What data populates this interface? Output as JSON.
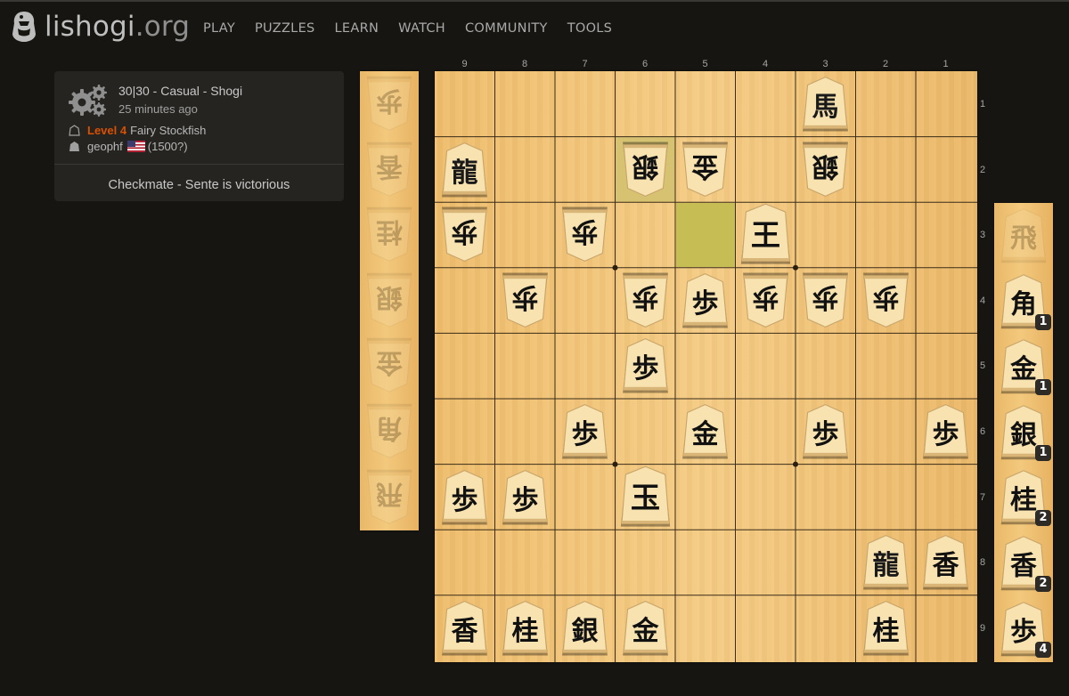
{
  "site": {
    "logo_name": "lishogi",
    "logo_tld": ".org",
    "nav": [
      "PLAY",
      "PUZZLES",
      "LEARN",
      "WATCH",
      "COMMUNITY",
      "TOOLS"
    ]
  },
  "game": {
    "title": "30|30 - Casual - Shogi",
    "time_ago": "25 minutes ago",
    "players": [
      {
        "level": "Level 4",
        "name": "Fairy Stockfish",
        "side": "gote"
      },
      {
        "name": "geophf",
        "flag": "us-flag",
        "rating": "(1500?)",
        "side": "sente"
      }
    ],
    "result": "Checkmate - Sente is victorious"
  },
  "board": {
    "files": [
      "9",
      "8",
      "7",
      "6",
      "5",
      "4",
      "3",
      "2",
      "1"
    ],
    "ranks": [
      "1",
      "2",
      "3",
      "4",
      "5",
      "6",
      "7",
      "8",
      "9"
    ],
    "highlights": [
      {
        "file": 6,
        "rank": 2,
        "color": "#d6c271"
      },
      {
        "file": 5,
        "rank": 3,
        "color": "#c7bd55"
      }
    ],
    "pieces": [
      {
        "file": 3,
        "rank": 1,
        "kanji": "馬",
        "owner": "sente"
      },
      {
        "file": 9,
        "rank": 2,
        "kanji": "龍",
        "owner": "sente"
      },
      {
        "file": 6,
        "rank": 2,
        "kanji": "銀",
        "owner": "gote"
      },
      {
        "file": 5,
        "rank": 2,
        "kanji": "金",
        "owner": "gote"
      },
      {
        "file": 3,
        "rank": 2,
        "kanji": "銀",
        "owner": "gote"
      },
      {
        "file": 9,
        "rank": 3,
        "kanji": "歩",
        "owner": "gote"
      },
      {
        "file": 7,
        "rank": 3,
        "kanji": "歩",
        "owner": "gote"
      },
      {
        "file": 4,
        "rank": 3,
        "kanji": "王",
        "owner": "sente"
      },
      {
        "file": 8,
        "rank": 4,
        "kanji": "歩",
        "owner": "gote"
      },
      {
        "file": 6,
        "rank": 4,
        "kanji": "歩",
        "owner": "gote"
      },
      {
        "file": 5,
        "rank": 4,
        "kanji": "歩",
        "owner": "sente"
      },
      {
        "file": 4,
        "rank": 4,
        "kanji": "歩",
        "owner": "gote"
      },
      {
        "file": 3,
        "rank": 4,
        "kanji": "歩",
        "owner": "gote"
      },
      {
        "file": 2,
        "rank": 4,
        "kanji": "歩",
        "owner": "gote"
      },
      {
        "file": 6,
        "rank": 5,
        "kanji": "歩",
        "owner": "sente"
      },
      {
        "file": 7,
        "rank": 6,
        "kanji": "歩",
        "owner": "sente"
      },
      {
        "file": 5,
        "rank": 6,
        "kanji": "金",
        "owner": "sente"
      },
      {
        "file": 3,
        "rank": 6,
        "kanji": "歩",
        "owner": "sente"
      },
      {
        "file": 1,
        "rank": 6,
        "kanji": "歩",
        "owner": "sente"
      },
      {
        "file": 9,
        "rank": 7,
        "kanji": "歩",
        "owner": "sente"
      },
      {
        "file": 8,
        "rank": 7,
        "kanji": "歩",
        "owner": "sente"
      },
      {
        "file": 6,
        "rank": 7,
        "kanji": "玉",
        "owner": "sente"
      },
      {
        "file": 2,
        "rank": 8,
        "kanji": "龍",
        "owner": "sente"
      },
      {
        "file": 1,
        "rank": 8,
        "kanji": "香",
        "owner": "sente"
      },
      {
        "file": 9,
        "rank": 9,
        "kanji": "香",
        "owner": "sente"
      },
      {
        "file": 8,
        "rank": 9,
        "kanji": "桂",
        "owner": "sente"
      },
      {
        "file": 7,
        "rank": 9,
        "kanji": "銀",
        "owner": "sente"
      },
      {
        "file": 6,
        "rank": 9,
        "kanji": "金",
        "owner": "sente"
      },
      {
        "file": 2,
        "rank": 9,
        "kanji": "桂",
        "owner": "sente"
      }
    ]
  },
  "gote_hand": [
    {
      "kanji": "歩"
    },
    {
      "kanji": "香"
    },
    {
      "kanji": "桂"
    },
    {
      "kanji": "銀"
    },
    {
      "kanji": "金"
    },
    {
      "kanji": "角"
    },
    {
      "kanji": "飛"
    }
  ],
  "sente_hand": [
    {
      "kanji": "飛",
      "count": null
    },
    {
      "kanji": "角",
      "count": "1"
    },
    {
      "kanji": "金",
      "count": "1"
    },
    {
      "kanji": "銀",
      "count": "1"
    },
    {
      "kanji": "桂",
      "count": "2"
    },
    {
      "kanji": "香",
      "count": "2"
    },
    {
      "kanji": "歩",
      "count": "4"
    }
  ]
}
